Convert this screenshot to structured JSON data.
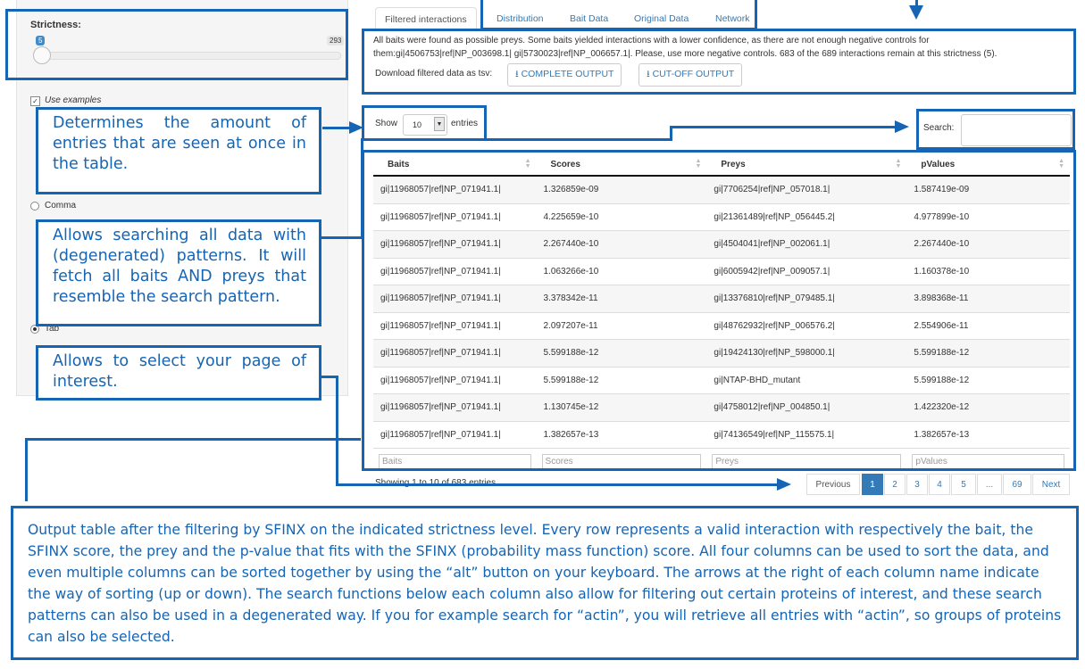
{
  "sidebar": {
    "strictness_label": "Strictness:",
    "slider_value": "5",
    "slider_max": "293",
    "use_examples": "Use examples",
    "option_comma": "Comma",
    "option_tab": "Tab"
  },
  "tabs": [
    "Filtered interactions",
    "Distribution",
    "Bait Data",
    "Original Data",
    "Network"
  ],
  "info": {
    "message": "All baits were found as possible preys. Some baits yielded interactions with a lower confidence, as there are not enough negative controls for them:gi|4506753|ref|NP_003698.1| gi|5730023|ref|NP_006657.1|. Please, use more negative controls. 683 of the 689 interactions remain at this strictness (5).",
    "download_label": "Download filtered data as tsv:",
    "complete_output": "COMPLETE OUTPUT",
    "cutoff_output": "CUT-OFF OUTPUT"
  },
  "table_controls": {
    "show_label": "Show",
    "entries_value": "10",
    "entries_label": "entries",
    "search_label": "Search:"
  },
  "table": {
    "columns": [
      "Baits",
      "Scores",
      "Preys",
      "pValues"
    ],
    "rows": [
      [
        "gi|11968057|ref|NP_071941.1|",
        "1.326859e-09",
        "gi|7706254|ref|NP_057018.1|",
        "1.587419e-09"
      ],
      [
        "gi|11968057|ref|NP_071941.1|",
        "4.225659e-10",
        "gi|21361489|ref|NP_056445.2|",
        "4.977899e-10"
      ],
      [
        "gi|11968057|ref|NP_071941.1|",
        "2.267440e-10",
        "gi|4504041|ref|NP_002061.1|",
        "2.267440e-10"
      ],
      [
        "gi|11968057|ref|NP_071941.1|",
        "1.063266e-10",
        "gi|6005942|ref|NP_009057.1|",
        "1.160378e-10"
      ],
      [
        "gi|11968057|ref|NP_071941.1|",
        "3.378342e-11",
        "gi|13376810|ref|NP_079485.1|",
        "3.898368e-11"
      ],
      [
        "gi|11968057|ref|NP_071941.1|",
        "2.097207e-11",
        "gi|48762932|ref|NP_006576.2|",
        "2.554906e-11"
      ],
      [
        "gi|11968057|ref|NP_071941.1|",
        "5.599188e-12",
        "gi|19424130|ref|NP_598000.1|",
        "5.599188e-12"
      ],
      [
        "gi|11968057|ref|NP_071941.1|",
        "5.599188e-12",
        "gi|NTAP-BHD_mutant",
        "5.599188e-12"
      ],
      [
        "gi|11968057|ref|NP_071941.1|",
        "1.130745e-12",
        "gi|4758012|ref|NP_004850.1|",
        "1.422320e-12"
      ],
      [
        "gi|11968057|ref|NP_071941.1|",
        "1.382657e-13",
        "gi|74136549|ref|NP_115575.1|",
        "1.382657e-13"
      ]
    ],
    "filter_placeholders": [
      "Baits",
      "Scores",
      "Preys",
      "pValues"
    ]
  },
  "footer": {
    "showing": "Showing 1 to 10 of 683 entries",
    "previous": "Previous",
    "pages": [
      "1",
      "2",
      "3",
      "4",
      "5",
      "...",
      "69"
    ],
    "next": "Next"
  },
  "annotations": {
    "entries_note": "Determines the amount of entries that are seen at once in the table.",
    "search_note": "Allows searching all data with (degenerated) patterns. It will fetch all baits AND preys that resemble the search pattern.",
    "page_note": "Allows to select your page of interest.",
    "output_note": "Output table after the filtering by SFINX on the indicated strictness level. Every row represents a valid interaction with respectively the bait, the SFINX score, the prey and the p-value that fits with the SFINX (probability mass function) score. All four columns can be used to sort the data, and even multiple columns can be sorted together by using the “alt” button on your keyboard. The arrows at the right of each column name indicate the way of sorting (up or down). The search functions below each column also allow for filtering out certain proteins of interest, and these search patterns can also be used in a degenerated way. If you for example search for “actin”, you will retrieve all entries with “actin”, so groups of proteins can also be selected."
  },
  "colors": {
    "annotation": "#1565b4",
    "link": "#337ab7",
    "active_page": "#337ab7"
  }
}
